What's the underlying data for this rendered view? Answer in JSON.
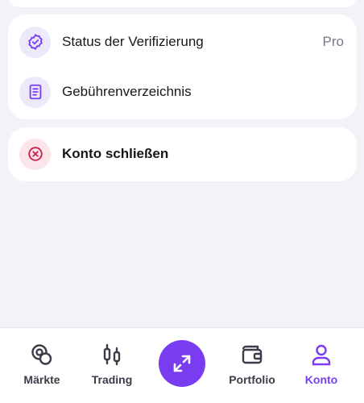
{
  "menu": {
    "items": [
      {
        "label": "Status der Verifizierung",
        "value": "Pro",
        "icon": "verified-badge-icon"
      },
      {
        "label": "Gebührenverzeichnis",
        "icon": "document-icon"
      }
    ]
  },
  "close_account": {
    "label": "Konto schließen",
    "icon": "close-circle-icon"
  },
  "tabbar": {
    "tabs": [
      {
        "label": "Märkte",
        "icon": "coins-icon"
      },
      {
        "label": "Trading",
        "icon": "candlestick-icon"
      },
      {
        "label": "",
        "icon": "swap-arrows-icon"
      },
      {
        "label": "Portfolio",
        "icon": "wallet-icon"
      },
      {
        "label": "Konto",
        "icon": "person-icon",
        "active": true
      }
    ]
  },
  "colors": {
    "accent": "#7a3cf0",
    "danger": "#c9234c",
    "background": "#f3f2f8"
  }
}
